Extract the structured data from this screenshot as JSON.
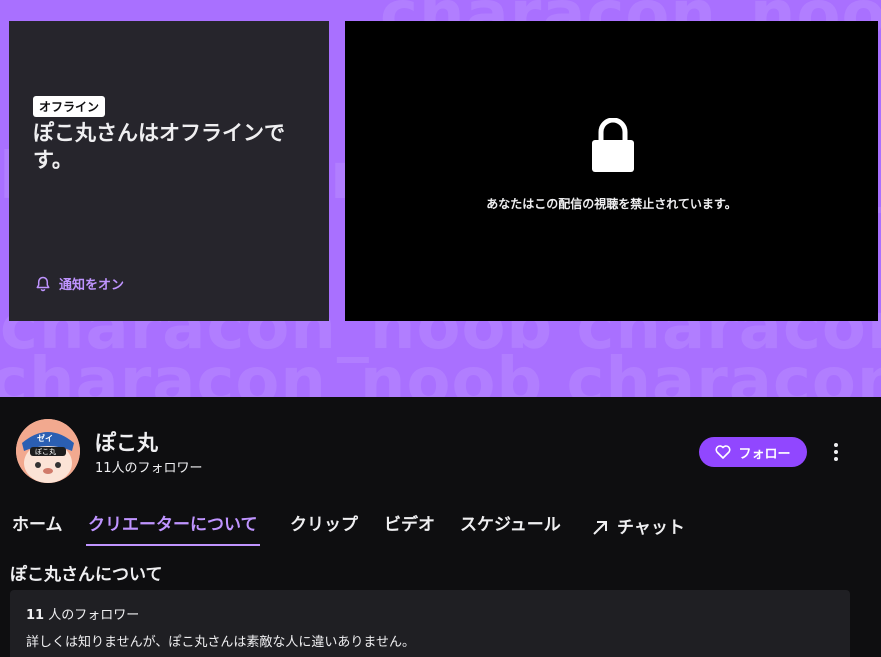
{
  "banner": {
    "watermark": "characon_noob characon_noob characon_noob",
    "offline_badge": "オフライン",
    "offline_title": "ぽこ丸さんはオフラインです。",
    "notify_label": "通知をオン"
  },
  "player": {
    "blocked_message": "あなたはこの配信の視聴を禁止されています。"
  },
  "profile": {
    "channel_name": "ぽこ丸",
    "followers_label": "11人のフォロワー",
    "follow_label": "フォロー",
    "avatar_text_top": "ゼイ",
    "avatar_text_mid": "ぽこ丸"
  },
  "tabs": [
    {
      "label": "ホーム",
      "active": false
    },
    {
      "label": "クリエーターについて",
      "active": true
    },
    {
      "label": "クリップ",
      "active": false
    },
    {
      "label": "ビデオ",
      "active": false
    },
    {
      "label": "スケジュール",
      "active": false
    },
    {
      "label": "チャット",
      "active": false
    }
  ],
  "about": {
    "heading": "ぽこ丸さんについて",
    "follower_count": "11",
    "follower_suffix": " 人のフォロワー",
    "description": "詳しくは知りませんが、ぽこ丸さんは素敵な人に違いありません。"
  },
  "colors": {
    "accent": "#a970ff",
    "follow_button": "#9147ff",
    "active_tab": "#bf94ff",
    "background": "#0e0e10"
  }
}
